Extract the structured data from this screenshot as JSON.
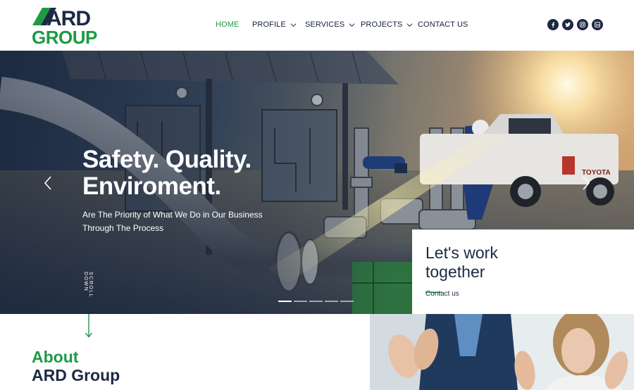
{
  "brand": {
    "logo_line1": "ARD",
    "logo_line2": "GROUP",
    "green": "#1e9a46",
    "navy": "#1c2a44"
  },
  "nav": {
    "items": [
      {
        "label": "HOME",
        "active": true,
        "dropdown": false
      },
      {
        "label": "PROFILE",
        "active": false,
        "dropdown": true
      },
      {
        "label": "SERVICES",
        "active": false,
        "dropdown": true
      },
      {
        "label": "PROJECTS",
        "active": false,
        "dropdown": true
      },
      {
        "label": "CONTACT US",
        "active": false,
        "dropdown": false
      }
    ]
  },
  "social": [
    "facebook-icon",
    "twitter-icon",
    "instagram-icon",
    "linkedin-icon"
  ],
  "hero": {
    "title_line1": "Safety. Quality.",
    "title_line2": "Enviroment.",
    "subtitle_line1": "Are The Priority of What We Do in Our Business",
    "subtitle_line2": "Through The Process",
    "scroll_label": "SCROLL DOWN",
    "slide_count": 5,
    "active_slide": 1,
    "truck_brand": "TOYOTA"
  },
  "work_card": {
    "title_line1": "Let's work",
    "title_line2": "together",
    "title_dash": "—",
    "link": "Contact us"
  },
  "about": {
    "line1": "About",
    "line2": "ARD Group"
  }
}
